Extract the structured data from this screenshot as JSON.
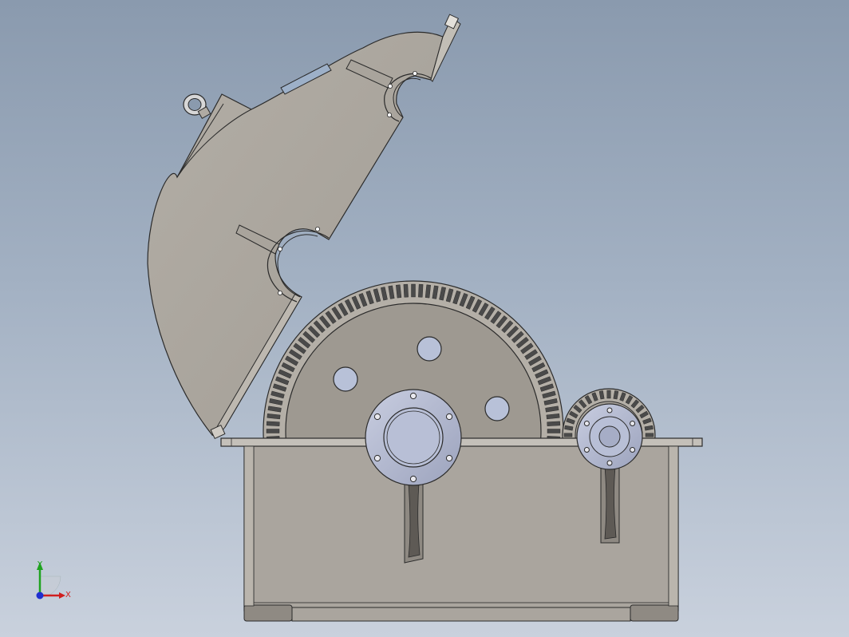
{
  "viewport": {
    "background_top": "#8a9aae",
    "background_bottom": "#c9d1dd"
  },
  "model": {
    "part_fill": "#aaa59e",
    "part_stroke": "#2b2b2b",
    "bore_fill": "#b8bfd6",
    "gear_dark": "#4a4a4a"
  },
  "triad": {
    "x_label": "X",
    "y_label": "Y",
    "x_color": "#d01f1f",
    "y_color": "#1fa31f",
    "z_color": "#1f2fd0"
  }
}
